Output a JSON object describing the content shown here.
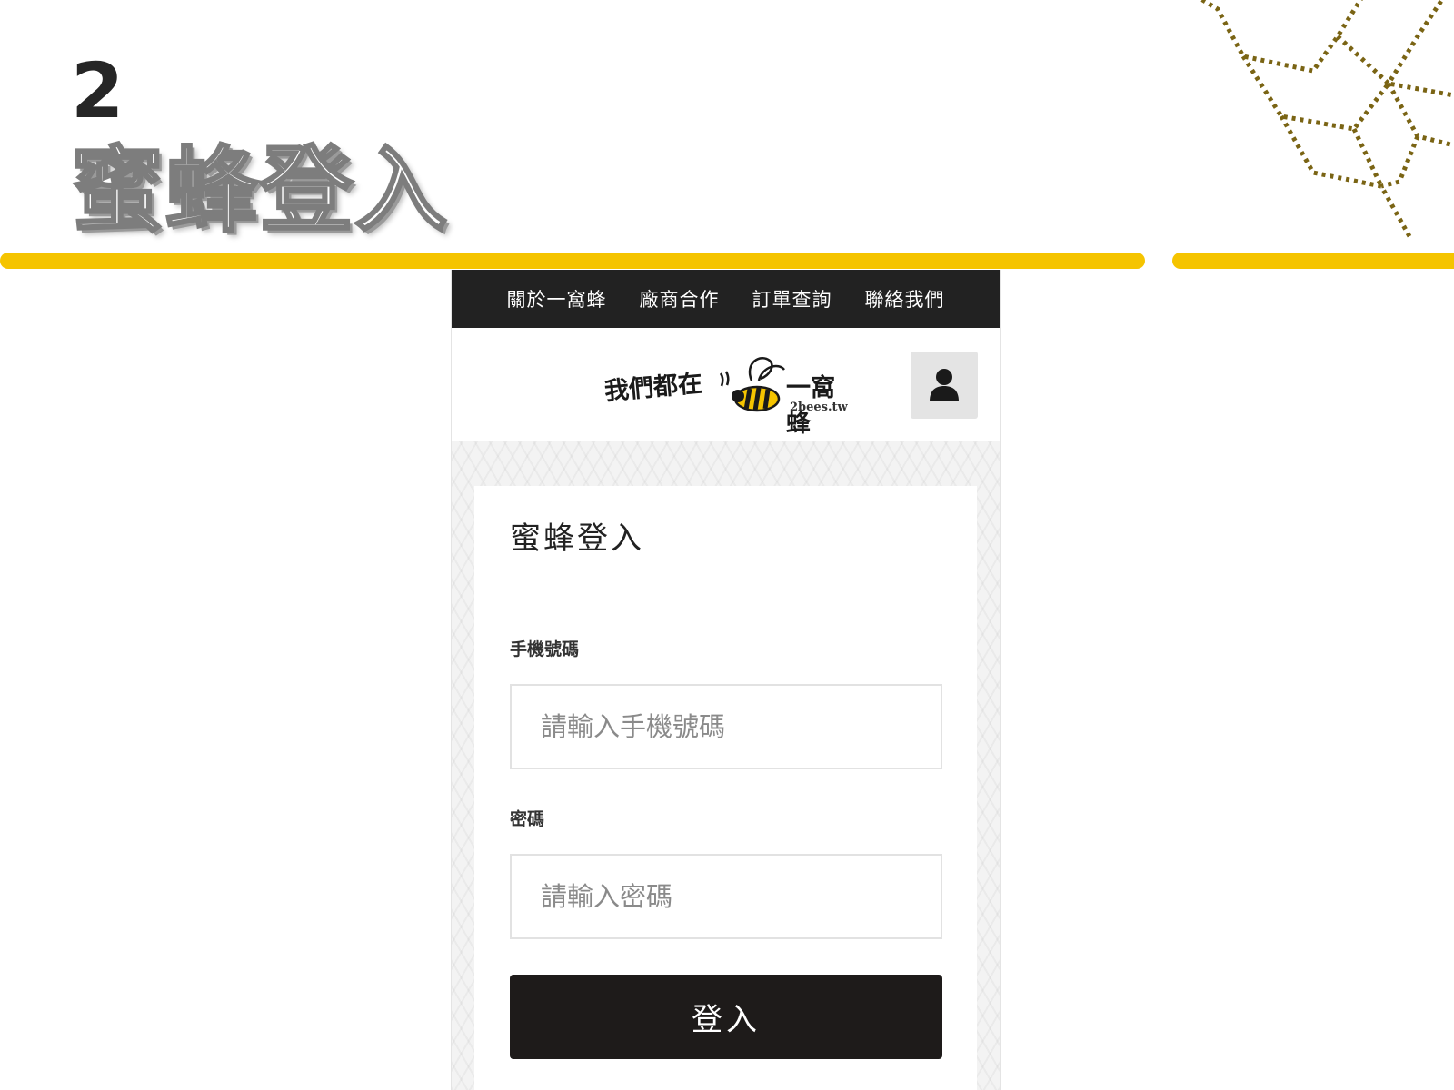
{
  "slide": {
    "number": "2",
    "title": "蜜蜂登入"
  },
  "colors": {
    "accent_gold": "#f5c400",
    "nav_background": "#222222",
    "button_background": "#1e1b1a"
  },
  "nav": {
    "items": [
      {
        "label": "關於一窩蜂"
      },
      {
        "label": "廠商合作"
      },
      {
        "label": "訂單查詢"
      },
      {
        "label": "聯絡我們"
      }
    ]
  },
  "brand": {
    "text_left": "我們都在",
    "text_right": "一窩蜂",
    "domain": "2bees.tw"
  },
  "account": {
    "icon": "user-icon"
  },
  "login": {
    "heading": "蜜蜂登入",
    "phone_label": "手機號碼",
    "phone_placeholder": "請輸入手機號碼",
    "password_label": "密碼",
    "password_placeholder": "請輸入密碼",
    "submit_label": "登入"
  }
}
